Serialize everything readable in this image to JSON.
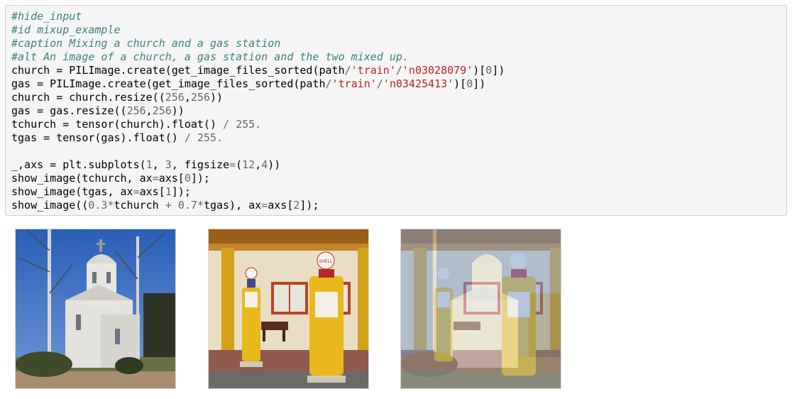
{
  "code_cell": {
    "lines": [
      [
        {
          "t": "#hide_input",
          "c": "comment"
        }
      ],
      [
        {
          "t": "#id mixup_example",
          "c": "comment"
        }
      ],
      [
        {
          "t": "#caption Mixing a church and a gas station",
          "c": "comment"
        }
      ],
      [
        {
          "t": "#alt An image of a church, a gas station and the two mixed up.",
          "c": "comment"
        }
      ],
      [
        {
          "t": "church = PILImage.create(get_image_files_sorted(path",
          "c": ""
        },
        {
          "t": "/",
          "c": "op"
        },
        {
          "t": "'train'",
          "c": "str"
        },
        {
          "t": "/",
          "c": "op"
        },
        {
          "t": "'n03028079'",
          "c": "str"
        },
        {
          "t": ")[",
          "c": ""
        },
        {
          "t": "0",
          "c": "num"
        },
        {
          "t": "])",
          "c": ""
        }
      ],
      [
        {
          "t": "gas = PILImage.create(get_image_files_sorted(path",
          "c": ""
        },
        {
          "t": "/",
          "c": "op"
        },
        {
          "t": "'train'",
          "c": "str"
        },
        {
          "t": "/",
          "c": "op"
        },
        {
          "t": "'n03425413'",
          "c": "str"
        },
        {
          "t": ")[",
          "c": ""
        },
        {
          "t": "0",
          "c": "num"
        },
        {
          "t": "])",
          "c": ""
        }
      ],
      [
        {
          "t": "church = church.resize((",
          "c": ""
        },
        {
          "t": "256",
          "c": "num"
        },
        {
          "t": ",",
          "c": ""
        },
        {
          "t": "256",
          "c": "num"
        },
        {
          "t": "))",
          "c": ""
        }
      ],
      [
        {
          "t": "gas = gas.resize((",
          "c": ""
        },
        {
          "t": "256",
          "c": "num"
        },
        {
          "t": ",",
          "c": ""
        },
        {
          "t": "256",
          "c": "num"
        },
        {
          "t": "))",
          "c": ""
        }
      ],
      [
        {
          "t": "tchurch = tensor(church).float() ",
          "c": ""
        },
        {
          "t": "/",
          "c": "op"
        },
        {
          "t": " ",
          "c": ""
        },
        {
          "t": "255.",
          "c": "num"
        }
      ],
      [
        {
          "t": "tgas = tensor(gas).float() ",
          "c": ""
        },
        {
          "t": "/",
          "c": "op"
        },
        {
          "t": " ",
          "c": ""
        },
        {
          "t": "255.",
          "c": "num"
        }
      ],
      [
        {
          "t": "",
          "c": ""
        }
      ],
      [
        {
          "t": "_,axs = plt.subplots(",
          "c": ""
        },
        {
          "t": "1",
          "c": "num"
        },
        {
          "t": ", ",
          "c": ""
        },
        {
          "t": "3",
          "c": "num"
        },
        {
          "t": ", figsize",
          "c": ""
        },
        {
          "t": "=",
          "c": "op"
        },
        {
          "t": "(",
          "c": ""
        },
        {
          "t": "12",
          "c": "num"
        },
        {
          "t": ",",
          "c": ""
        },
        {
          "t": "4",
          "c": "num"
        },
        {
          "t": "))",
          "c": ""
        }
      ],
      [
        {
          "t": "show_image(tchurch, ax",
          "c": ""
        },
        {
          "t": "=",
          "c": "op"
        },
        {
          "t": "axs[",
          "c": ""
        },
        {
          "t": "0",
          "c": "num"
        },
        {
          "t": "]);",
          "c": ""
        }
      ],
      [
        {
          "t": "show_image(tgas, ax",
          "c": ""
        },
        {
          "t": "=",
          "c": "op"
        },
        {
          "t": "axs[",
          "c": ""
        },
        {
          "t": "1",
          "c": "num"
        },
        {
          "t": "]);",
          "c": ""
        }
      ],
      [
        {
          "t": "show_image((",
          "c": ""
        },
        {
          "t": "0.3",
          "c": "num"
        },
        {
          "t": "*",
          "c": "op"
        },
        {
          "t": "tchurch ",
          "c": ""
        },
        {
          "t": "+",
          "c": "op"
        },
        {
          "t": " ",
          "c": ""
        },
        {
          "t": "0.7",
          "c": "num"
        },
        {
          "t": "*",
          "c": "op"
        },
        {
          "t": "tgas), ax",
          "c": ""
        },
        {
          "t": "=",
          "c": "op"
        },
        {
          "t": "axs[",
          "c": ""
        },
        {
          "t": "2",
          "c": "num"
        },
        {
          "t": "]);",
          "c": ""
        }
      ]
    ]
  },
  "output": {
    "gas_sign_text": "SHELL",
    "images": [
      "church-photo",
      "gas-station-photo",
      "mixed-photo"
    ]
  },
  "colors": {
    "comment": "#408080",
    "string": "#ba2121",
    "number": "#666666",
    "cell_bg": "#f5f5f5",
    "pump_yellow": "#e8b81c"
  }
}
